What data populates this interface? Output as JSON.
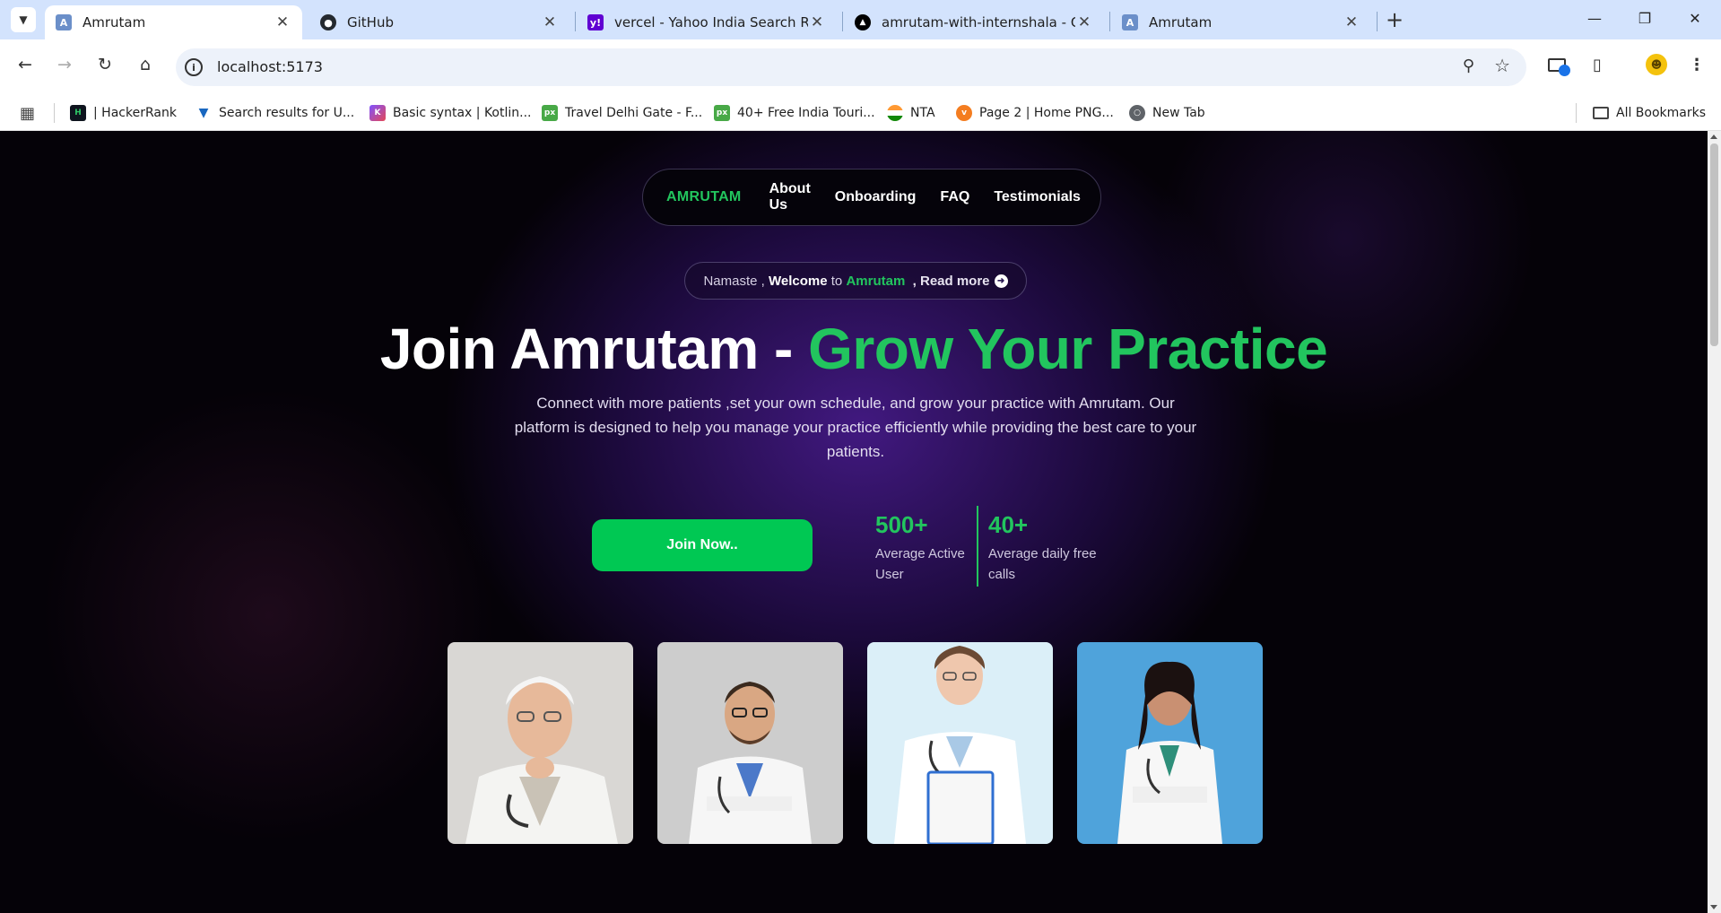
{
  "browser": {
    "tabs": [
      {
        "title": "Amrutam",
        "active": true,
        "favicon": "amrutam-favicon"
      },
      {
        "title": "GitHub",
        "active": false,
        "favicon": "github-icon"
      },
      {
        "title": "vercel - Yahoo India Search Resu",
        "active": false,
        "favicon": "yahoo-icon"
      },
      {
        "title": "amrutam-with-internshala - Ove",
        "active": false,
        "favicon": "vercel-icon"
      },
      {
        "title": "Amrutam",
        "active": false,
        "favicon": "amrutam-favicon"
      }
    ],
    "address": "localhost:5173",
    "bookmarks": [
      {
        "label": "| HackerRank",
        "icon": "hackerrank-icon"
      },
      {
        "label": "Search results for U...",
        "icon": "vuetify-icon"
      },
      {
        "label": "Basic syntax | Kotlin...",
        "icon": "kotlin-icon"
      },
      {
        "label": "Travel Delhi Gate - F...",
        "icon": "pixabay-icon"
      },
      {
        "label": "40+ Free India Touri...",
        "icon": "pixabay-icon"
      },
      {
        "label": "NTA",
        "icon": "nta-icon"
      },
      {
        "label": "Page 2 | Home PNG...",
        "icon": "vecteezy-icon"
      },
      {
        "label": "New Tab",
        "icon": "globe-icon"
      }
    ],
    "all_bookmarks": "All Bookmarks"
  },
  "site": {
    "nav": {
      "brand": "AMRUTAM",
      "links": [
        "About Us",
        "Onboarding",
        "FAQ",
        "Testimonials"
      ]
    },
    "pill": {
      "part1": "Namaste , ",
      "part2": "Welcome",
      "part3": " to ",
      "part4": "Amrutam",
      "part5": "  , Read more"
    },
    "headline": {
      "white": "Join Amrutam - ",
      "green": "Grow Your Practice"
    },
    "subtext": "Connect with more patients ,set your own schedule, and grow your practice with Amrutam. Our platform is designed to help you manage your practice efficiently while providing the best care to your patients.",
    "cta": "Join Now..",
    "stats": [
      {
        "value": "500+",
        "label": "Average Active User"
      },
      {
        "value": "40+",
        "label": "Average daily free calls"
      }
    ]
  },
  "colors": {
    "accent_green": "#22c55e",
    "button_green": "#00c853",
    "background_purple": "#4c1d95"
  }
}
